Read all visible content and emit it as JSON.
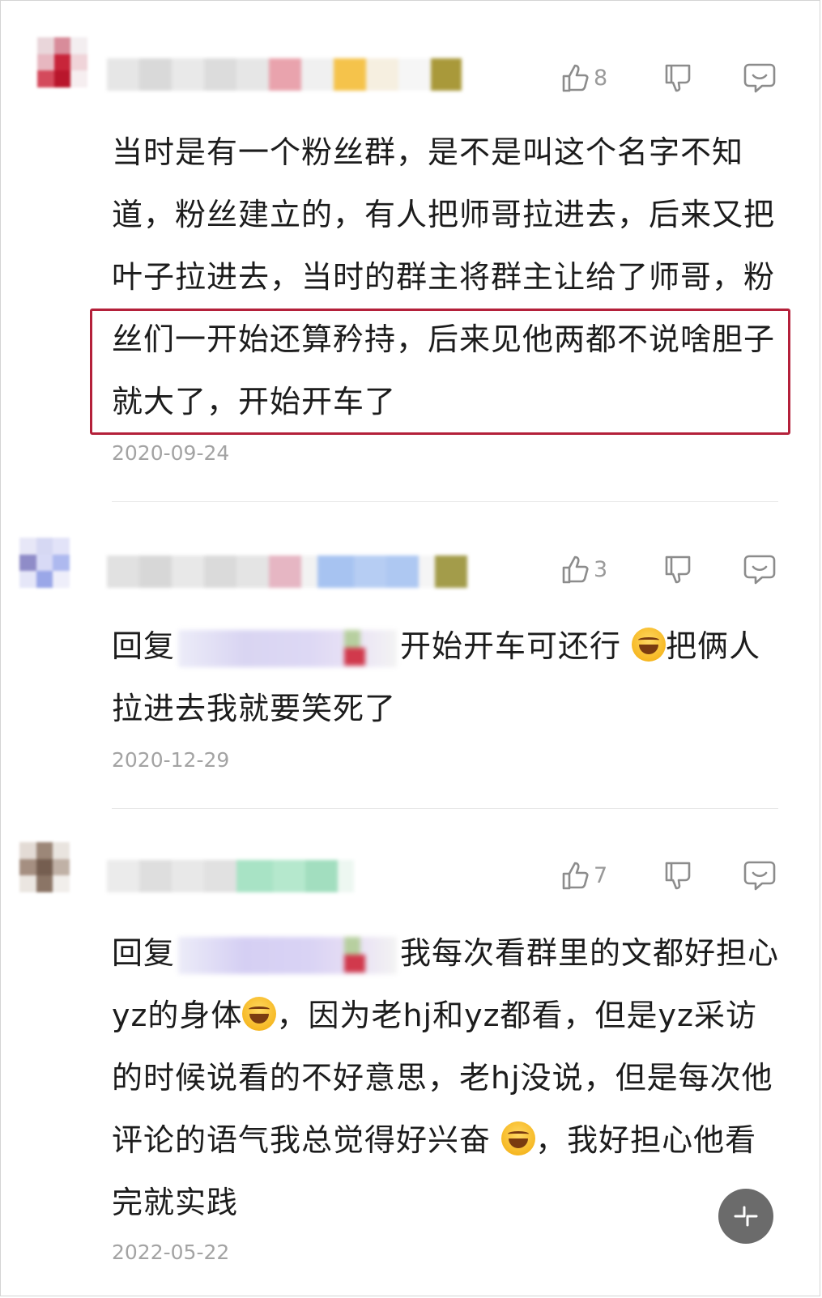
{
  "comments": [
    {
      "likes": "8",
      "text_before": "当时是有一个粉丝群，是不是叫这个名字不知道，粉丝建立的，有人把师哥拉进去，后来又把叶子拉进去，当时的群主将群主让给",
      "text_highlight": "了师哥，粉丝们一开始还算矜持，后来见他两都不说啥胆子就大了，开始开车了",
      "date": "2020-09-24"
    },
    {
      "likes": "3",
      "reply_prefix": "回复",
      "text_a": "开始开车可还行",
      "text_b": "把俩人拉进去我就要笑死了",
      "date": "2020-12-29"
    },
    {
      "likes": "7",
      "reply_prefix": "回复",
      "text_a": "我每次看群里的文都好担心yz的身体",
      "text_b": "，因为老hj和yz都看，但是yz采访的时候说看的不好意思，老hj没说，但是每次他评论的语气我总觉得好兴奋",
      "text_c": "，我好担心他看完就实践",
      "date": "2022-05-22"
    }
  ],
  "icons": {
    "like": "thumbs-up-icon",
    "dislike": "thumbs-down-icon",
    "reply": "comment-bubble-icon",
    "scroll": "collapse-icon"
  },
  "colors": {
    "highlight_border": "#b4203a",
    "date": "#a3a3a3",
    "icon": "#8c8c8c"
  }
}
